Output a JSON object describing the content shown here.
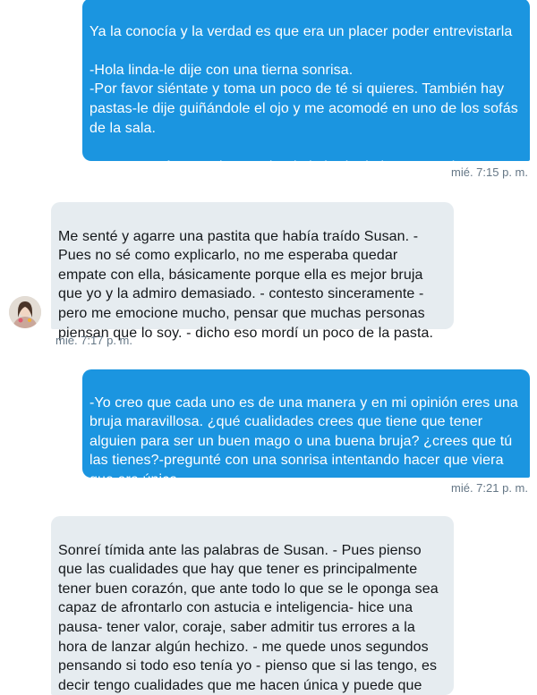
{
  "messages": [
    {
      "direction": "outgoing",
      "text": "Ya la conocía y la verdad es que era un placer poder entrevistarla\n\n-Hola linda-le dije con una tierna sonrisa.\n-Por favor siéntate y toma un poco de té si quieres. También hay pastas-le dije guiñándole el ojo y me acomodé en uno de los sofás de la sala.\n\n-Bueno. ¿Cómo te sientes siendo la bruja de la semana junto a Syl?",
      "timestamp": "mié. 7:15 p. m."
    },
    {
      "direction": "incoming",
      "text": "Me senté y agarre una pastita que había traído Susan. - Pues no sé como explicarlo, no me esperaba quedar empate con ella, básicamente porque ella es mejor bruja que yo y la admiro demasiado. - contesto sinceramente - pero me emocione mucho, pensar que muchas personas piensan que lo soy. - dicho eso mordí un poco de la pasta.",
      "timestamp": "mié. 7:17 p. m."
    },
    {
      "direction": "outgoing",
      "text": "-Yo creo que cada uno es de una manera y en mi opinión eres una bruja maravillosa. ¿qué cualidades crees que tiene que tener alguien para ser un buen mago o una buena bruja? ¿crees que tú las tienes?-pregunté con una sonrisa intentando hacer que viera que era única.",
      "timestamp": "mié. 7:21 p. m."
    },
    {
      "direction": "incoming",
      "text": "Sonreí tímida ante las palabras de Susan. - Pues pienso que las cualidades que hay que tener es principalmente tener buen corazón, que ante todo lo que se le oponga sea capaz de afrontarlo con astucia e inteligencia- hice una pausa- tener valor, coraje, saber admitir tus errores a la hora de lanzar algún hechizo. - me quede unos segundos pensando si todo eso  tenía yo - pienso que si las tengo, es decir tengo cualidades que me hacen única y puede que eso me haga"
    }
  ],
  "colors": {
    "outgoing_bubble": "#1b95e0",
    "incoming_bubble": "#e6ecf0",
    "timestamp": "#657786"
  },
  "icons": {
    "avatar": "contact-avatar"
  }
}
